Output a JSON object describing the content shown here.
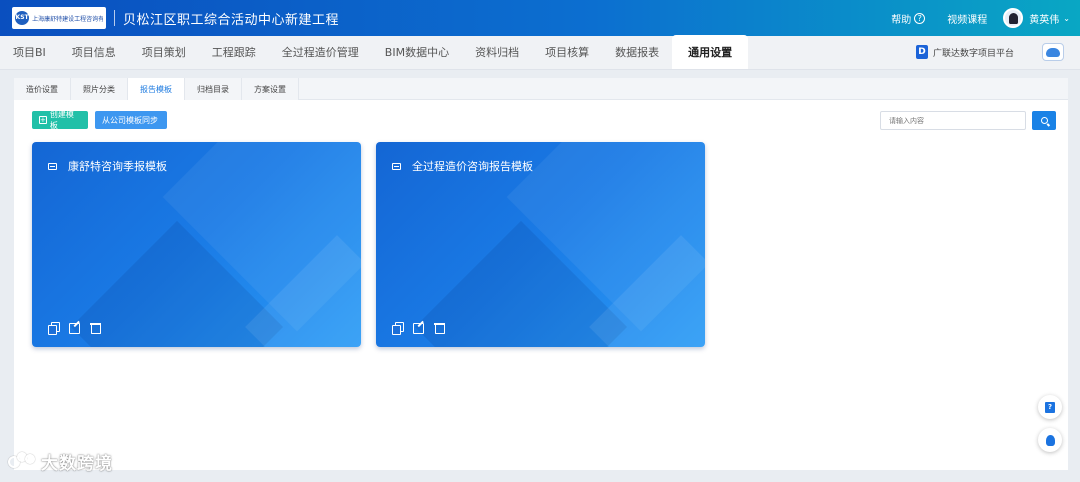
{
  "header": {
    "logo_text": "上海康舒特建设工程咨询有限公司",
    "project_title": "贝松江区职工综合活动中心新建工程",
    "help_label": "帮助",
    "video_label": "视频课程",
    "user_name": "黄英伟"
  },
  "nav": {
    "items": [
      {
        "label": "项目BI"
      },
      {
        "label": "项目信息"
      },
      {
        "label": "项目策划"
      },
      {
        "label": "工程跟踪"
      },
      {
        "label": "全过程造价管理"
      },
      {
        "label": "BIM数据中心"
      },
      {
        "label": "资料归档"
      },
      {
        "label": "项目核算"
      },
      {
        "label": "数据报表"
      },
      {
        "label": "通用设置",
        "active": true
      }
    ],
    "platform_label": "广联达数字项目平台"
  },
  "subtabs": [
    {
      "label": "造价设置"
    },
    {
      "label": "照片分类"
    },
    {
      "label": "报告模板",
      "active": true
    },
    {
      "label": "归档目录"
    },
    {
      "label": "方案设置"
    }
  ],
  "toolbar": {
    "create_label": "创建模板",
    "sync_label": "从公司模板同步",
    "search_placeholder": "请输入内容"
  },
  "templates": [
    {
      "title": "康舒特咨询季报模板"
    },
    {
      "title": "全过程造价咨询报告模板"
    }
  ],
  "watermark": "大数跨境",
  "colors": {
    "header_start": "#0a4fbf",
    "header_end": "#09a7c4",
    "accent": "#1a82e6",
    "create_button": "#21c0a8",
    "sync_button": "#3d97f0",
    "card": "#1a7be6"
  }
}
